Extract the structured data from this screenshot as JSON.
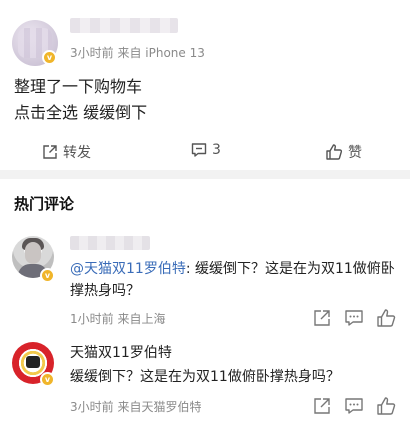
{
  "post": {
    "meta": "3小时前  来自 iPhone 13",
    "body_lines": [
      "整理了一下购物车",
      "点击全选 缓缓倒下"
    ],
    "actions": {
      "repost_label": "转发",
      "comment_count": "3",
      "like_label": "赞"
    }
  },
  "hot_comments": {
    "title": "热门评论",
    "items": [
      {
        "mention": "@天猫双11罗伯特",
        "text": ": 缓缓倒下？这是在为双11做俯卧撑热身吗？",
        "meta": "1小时前  来自上海"
      },
      {
        "name": "天猫双11罗伯特",
        "text": "缓缓倒下？这是在为双11做俯卧撑热身吗？",
        "meta": "3小时前  来自天猫罗伯特"
      }
    ]
  },
  "icons": {
    "repost": "share-out-icon",
    "comment": "comment-icon",
    "like": "thumbs-up-icon",
    "verified": "verified-badge-icon"
  },
  "colors": {
    "mention": "#3a6cb8",
    "verified": "#f0b52a",
    "meta_text": "#8a8a8a",
    "divider": "#f2f2f2"
  }
}
